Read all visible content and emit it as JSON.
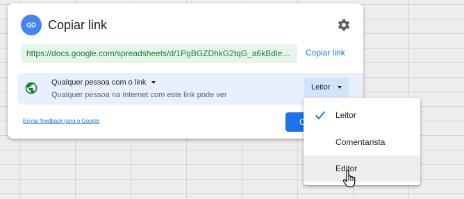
{
  "dialog": {
    "title": "Copiar link",
    "url": "https://docs.google.com/spreadsheets/d/1PgBGZDhkG2tqG_a6kBdlerMB...",
    "copy_label": "Copiar link",
    "access": {
      "who": "Qualquer pessoa com o link",
      "description": "Qualquer pessoa na Internet com este link pode ver",
      "role": "Leitor"
    },
    "feedback_link": "Enviar feedback para o Google",
    "done_label": "C"
  },
  "role_menu": {
    "items": [
      {
        "label": "Leitor",
        "selected": true
      },
      {
        "label": "Comentarista",
        "selected": false
      },
      {
        "label": "Editor",
        "selected": false,
        "hovered": true
      }
    ]
  },
  "icons": {
    "link": "link-icon",
    "settings": "gear-icon",
    "visibility": "globe-icon",
    "check": "check-icon",
    "cursor": "hand-pointer-icon"
  },
  "colors": {
    "accent": "#1a73e8",
    "url_text": "#188038",
    "url_bg": "#e6f4ea",
    "access_bg": "#e8f0fe",
    "globe": "#188038"
  }
}
